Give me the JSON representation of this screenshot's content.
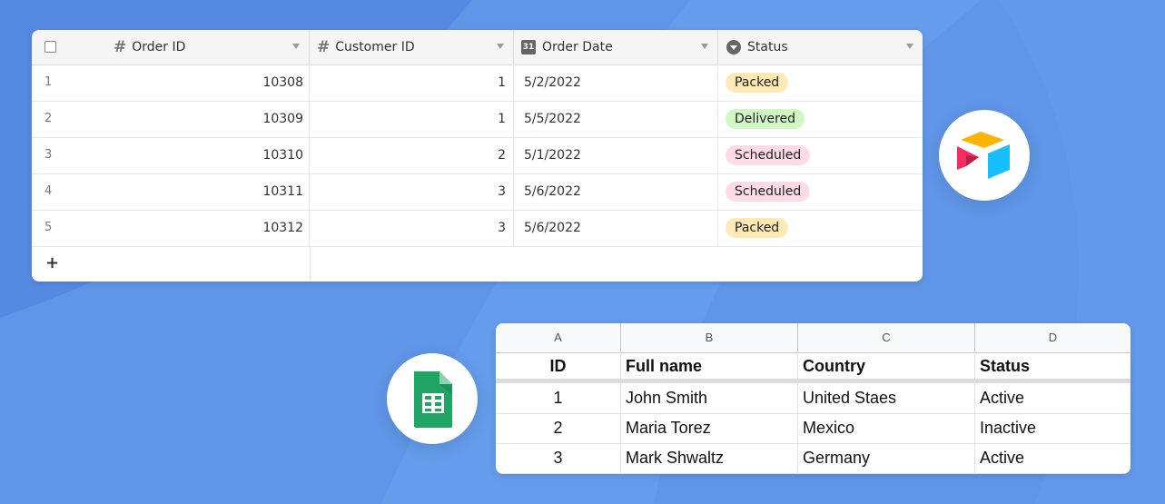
{
  "airtable": {
    "columns": [
      {
        "label": "Order ID",
        "icon": "hash-icon"
      },
      {
        "label": "Customer ID",
        "icon": "hash-icon"
      },
      {
        "label": "Order Date",
        "icon": "calendar-icon",
        "icon_text": "31"
      },
      {
        "label": "Status",
        "icon": "single-select-icon"
      }
    ],
    "rows": [
      {
        "num": "1",
        "order_id": "10308",
        "customer_id": "1",
        "date": "5/2/2022",
        "status": "Packed",
        "status_color": "#ffeab6"
      },
      {
        "num": "2",
        "order_id": "10309",
        "customer_id": "1",
        "date": "5/5/2022",
        "status": "Delivered",
        "status_color": "#d1f7c4"
      },
      {
        "num": "3",
        "order_id": "10310",
        "customer_id": "2",
        "date": "5/1/2022",
        "status": "Scheduled",
        "status_color": "#ffdce5"
      },
      {
        "num": "4",
        "order_id": "10311",
        "customer_id": "3",
        "date": "5/6/2022",
        "status": "Scheduled",
        "status_color": "#ffdce5"
      },
      {
        "num": "5",
        "order_id": "10312",
        "customer_id": "3",
        "date": "5/6/2022",
        "status": "Packed",
        "status_color": "#ffeab6"
      }
    ],
    "add_label": "+"
  },
  "sheets": {
    "column_letters": [
      "A",
      "B",
      "C",
      "D"
    ],
    "header": [
      "ID",
      "Full name",
      "Country",
      "Status"
    ],
    "rows": [
      [
        "1",
        "John Smith",
        "United Staes",
        "Active"
      ],
      [
        "2",
        "Maria Torez",
        "Mexico",
        "Inactive"
      ],
      [
        "3",
        "Mark Shwaltz",
        "Germany",
        "Active"
      ]
    ]
  },
  "colors": {
    "background": "#5f93e6",
    "sheets_green": "#1fa463",
    "airtable_yellow": "#fcb400",
    "airtable_blue": "#18bfff",
    "airtable_red": "#f82b60"
  }
}
